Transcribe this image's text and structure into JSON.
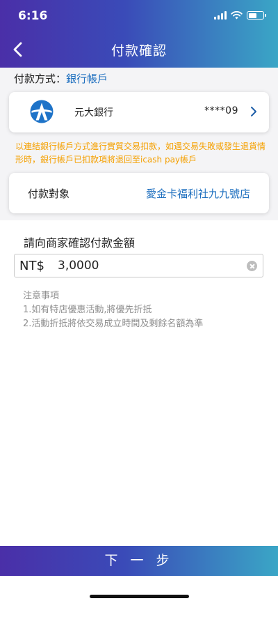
{
  "status_bar": {
    "time": "6:16"
  },
  "header": {
    "title": "付款確認",
    "back_icon": "chevron-left-icon"
  },
  "payment_method": {
    "label": "付款方式：",
    "value": "銀行帳戶"
  },
  "bank": {
    "logo_icon": "bank-logo-icon",
    "name": "元大銀行",
    "account": "****09",
    "chevron_icon": "chevron-right-icon"
  },
  "notice": "以連結銀行帳戶方式進行實質交易扣款，如遇交易失敗或發生退貨情形時，銀行帳戶已扣款項將退回至icash pay帳戶",
  "merchant": {
    "label": "付款對象",
    "value": "愛金卡福利社九九號店"
  },
  "amount": {
    "label": "請向商家確認付款金額",
    "currency": "NT$",
    "value": "3,0000",
    "clear_icon": "clear-icon"
  },
  "notes": {
    "title": "注意事項",
    "items": [
      "1.如有特店優惠活動,將優先折抵",
      "2.活動折抵將依交易成立時間及剩餘名額為準"
    ]
  },
  "footer": {
    "next_label": "下 一 步"
  },
  "colors": {
    "gradient_start": "#4a2fa8",
    "gradient_end": "#3aa6c6",
    "link_blue": "#1e6fbf",
    "notice_orange": "#f5a000"
  }
}
